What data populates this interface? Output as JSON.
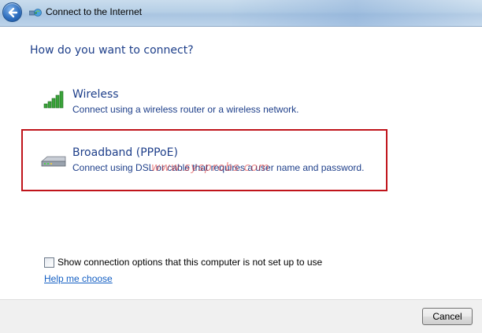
{
  "window": {
    "title": "Connect to the Internet",
    "back_icon": "back-arrow-icon",
    "title_icon": "network-connection-icon"
  },
  "main": {
    "heading": "How do you want to connect?",
    "options": [
      {
        "title": "Wireless",
        "description": "Connect using a wireless router or a wireless network.",
        "icon": "wireless-signal-icon"
      },
      {
        "title": "Broadband (PPPoE)",
        "description": "Connect using DSL or cable that requires a user name and password.",
        "icon": "broadband-modem-icon",
        "highlighted": true
      }
    ],
    "watermark": "www.sysprobs.com",
    "show_options_checkbox": {
      "label": "Show connection options that this computer is not set up to use",
      "checked": false
    },
    "help_link": "Help me choose"
  },
  "footer": {
    "cancel_label": "Cancel"
  },
  "colors": {
    "heading_blue": "#1e3f8a",
    "link_blue": "#1560c4",
    "highlight_red": "#c0141b",
    "signal_green": "#3aa43a"
  }
}
